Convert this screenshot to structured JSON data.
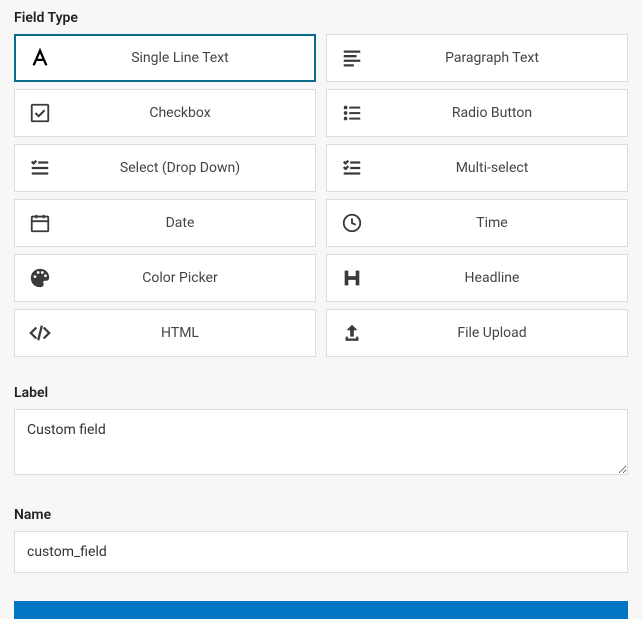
{
  "field_type": {
    "label": "Field Type",
    "options": [
      {
        "id": "single-line-text",
        "label": "Single Line Text",
        "selected": true
      },
      {
        "id": "paragraph-text",
        "label": "Paragraph Text",
        "selected": false
      },
      {
        "id": "checkbox",
        "label": "Checkbox",
        "selected": false
      },
      {
        "id": "radio-button",
        "label": "Radio Button",
        "selected": false
      },
      {
        "id": "select",
        "label": "Select (Drop Down)",
        "selected": false
      },
      {
        "id": "multi-select",
        "label": "Multi-select",
        "selected": false
      },
      {
        "id": "date",
        "label": "Date",
        "selected": false
      },
      {
        "id": "time",
        "label": "Time",
        "selected": false
      },
      {
        "id": "color-picker",
        "label": "Color Picker",
        "selected": false
      },
      {
        "id": "headline",
        "label": "Headline",
        "selected": false
      },
      {
        "id": "html",
        "label": "HTML",
        "selected": false
      },
      {
        "id": "file-upload",
        "label": "File Upload",
        "selected": false
      }
    ]
  },
  "label_field": {
    "heading": "Label",
    "value": "Custom field"
  },
  "name_field": {
    "heading": "Name",
    "value": "custom_field"
  }
}
